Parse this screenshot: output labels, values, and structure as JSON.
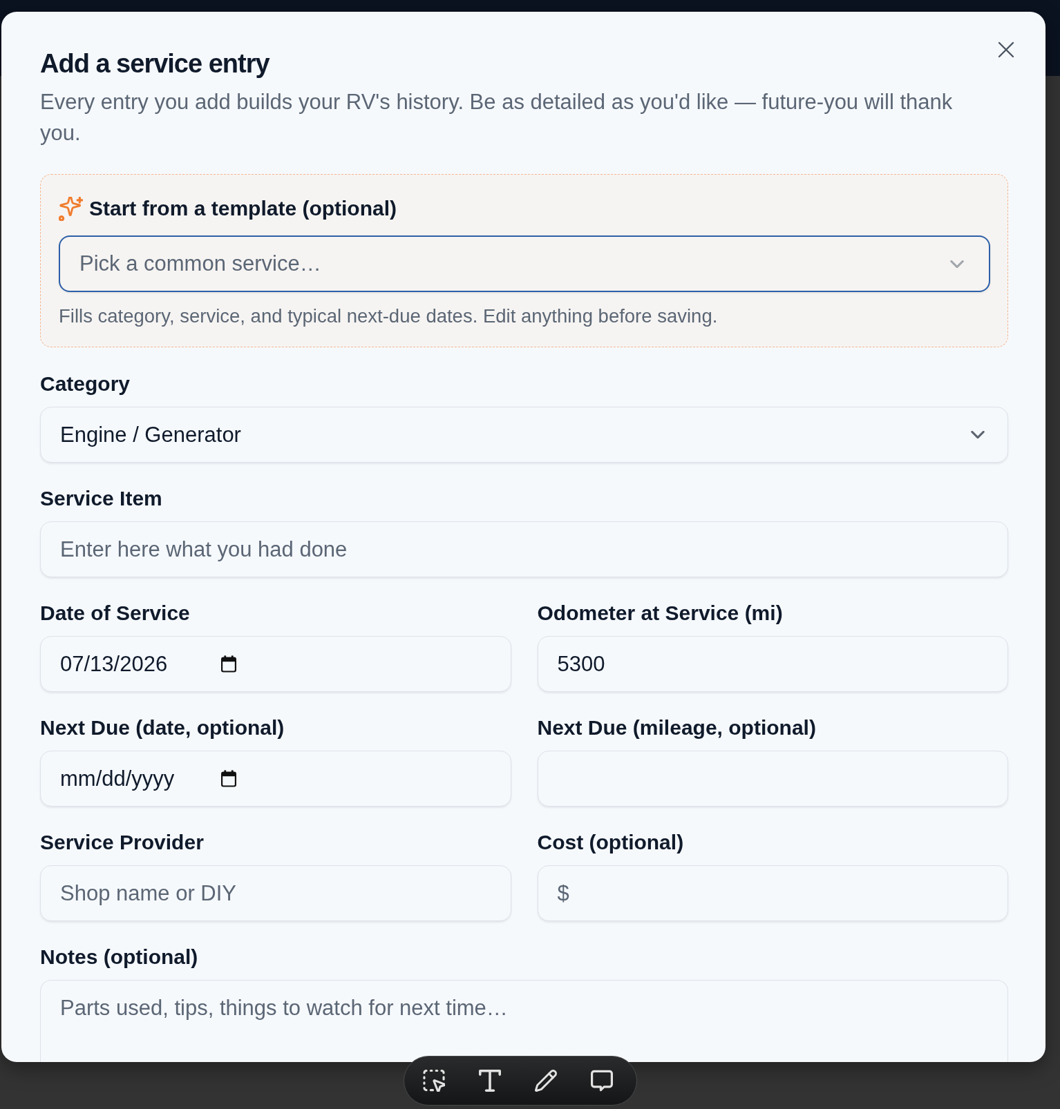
{
  "dialog": {
    "title": "Add a service entry",
    "subtitle": "Every entry you add builds your RV's history. Be as detailed as you'd like — future-you will thank you.",
    "template": {
      "label": "Start from a template (optional)",
      "select": {
        "placeholder": "Pick a common service…",
        "focused": true
      },
      "hint": "Fills category, service, and typical next-due dates. Edit anything before saving."
    },
    "rows": [
      {
        "fields": [
          {
            "kind": "select",
            "label": "Category",
            "value": "Engine / Generator"
          }
        ]
      },
      {
        "fields": [
          {
            "kind": "text",
            "label": "Service Item",
            "placeholder": "Enter here what you had done"
          }
        ]
      },
      {
        "fields": [
          {
            "kind": "date",
            "label": "Date of Service",
            "value": "07/13/2026"
          },
          {
            "kind": "text",
            "label": "Odometer at Service (mi)",
            "value": "5300"
          }
        ]
      },
      {
        "fields": [
          {
            "kind": "date",
            "label": "Next Due (date, optional)",
            "placeholder": "mm/dd/yyyy"
          },
          {
            "kind": "text",
            "label": "Next Due (mileage, optional)"
          }
        ]
      },
      {
        "fields": [
          {
            "kind": "text",
            "label": "Service Provider",
            "placeholder": "Shop name or DIY"
          },
          {
            "kind": "currency",
            "label": "Cost (optional)",
            "prefix": "$"
          }
        ]
      },
      {
        "fields": [
          {
            "kind": "textarea",
            "label": "Notes (optional)",
            "placeholder": "Parts used, tips, things to watch for next time…"
          }
        ]
      }
    ]
  },
  "toolbar": {
    "tools": [
      {
        "kind": "select"
      },
      {
        "kind": "text"
      },
      {
        "kind": "draw"
      },
      {
        "kind": "comment"
      }
    ]
  }
}
